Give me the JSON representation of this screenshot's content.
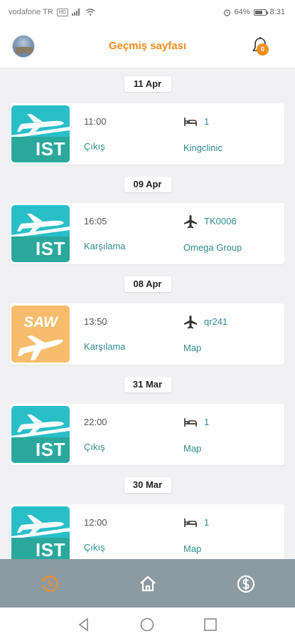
{
  "status_bar": {
    "carrier": "vodafone TR",
    "network_badge": "HD",
    "battery": "64%",
    "time": "8:31"
  },
  "header": {
    "title": "Geçmiş sayfası",
    "notification_count": "0"
  },
  "groups": [
    {
      "date": "11 Apr",
      "airport": "IST",
      "time": "11:00",
      "type": "Çıkış",
      "info_icon": "bed-icon",
      "info": "1",
      "place": "Kingclinic"
    },
    {
      "date": "09 Apr",
      "airport": "IST",
      "time": "16:05",
      "type": "Karşılama",
      "info_icon": "plane-icon",
      "info": "TK0006",
      "place": "Omega Group"
    },
    {
      "date": "08 Apr",
      "airport": "SAW",
      "time": "13:50",
      "type": "Karşılama",
      "info_icon": "plane-icon",
      "info": "qr241",
      "place": "Map"
    },
    {
      "date": "31 Mar",
      "airport": "IST",
      "time": "22:00",
      "type": "Çıkış",
      "info_icon": "bed-icon",
      "info": "1",
      "place": "Map"
    },
    {
      "date": "30 Mar",
      "airport": "IST",
      "time": "12:00",
      "type": "Çıkış",
      "info_icon": "bed-icon",
      "info": "1",
      "place": "Map"
    }
  ],
  "bottom_nav": [
    {
      "icon": "history-icon",
      "active": true
    },
    {
      "icon": "home-icon",
      "active": false
    },
    {
      "icon": "dollar-icon",
      "active": false
    }
  ],
  "colors": {
    "accent": "#f28c1f",
    "teal_text": "#2e8c8c",
    "ist_tile": "#29bfc9",
    "saw_tile": "#f7bd6c",
    "nav_bg": "#8c9aa1"
  }
}
